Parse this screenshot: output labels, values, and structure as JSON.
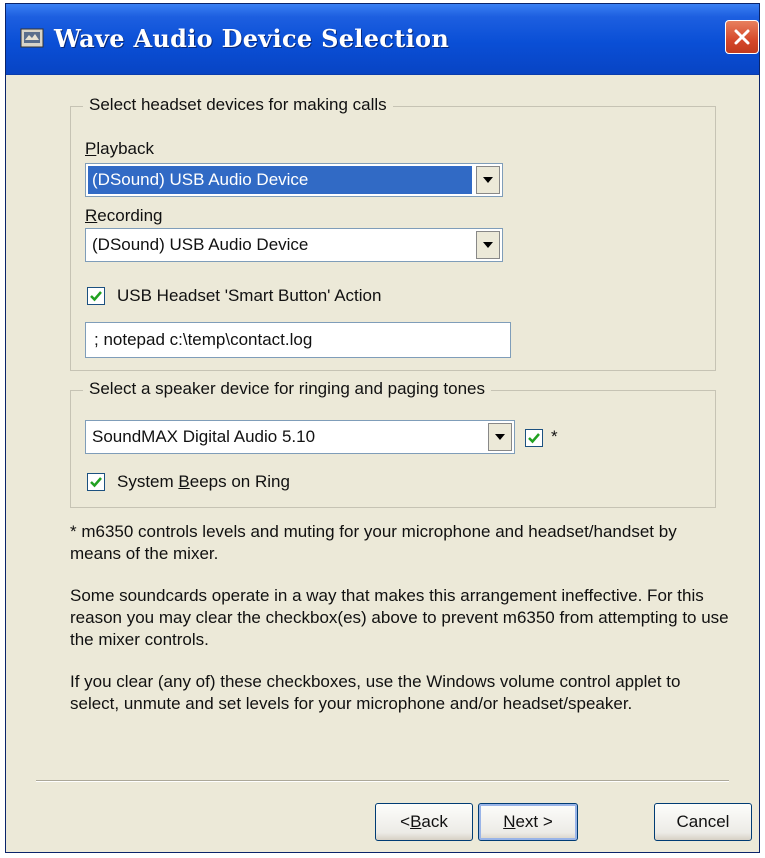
{
  "window": {
    "title": "Wave Audio Device Selection"
  },
  "headset_group": {
    "label": "Select headset devices for making calls",
    "playback": {
      "label_accel": "P",
      "label_rest": "layback",
      "value": "(DSound) USB Audio Device"
    },
    "recording": {
      "label_accel": "R",
      "label_rest": "ecording",
      "value": "(DSound) USB Audio Device"
    },
    "smart_button": {
      "checked": true,
      "label": "USB Headset 'Smart Button' Action"
    },
    "action_command": "; notepad c:\\temp\\contact.log"
  },
  "speaker_group": {
    "label": "Select a speaker device for ringing and paging tones",
    "device": {
      "value": "SoundMAX Digital Audio 5.10",
      "mixer_checked": true,
      "mixer_marker": "*"
    },
    "system_beeps": {
      "checked": true,
      "label_pre": "System ",
      "label_accel": "B",
      "label_rest": "eeps on Ring"
    }
  },
  "notes": {
    "p1": "* m6350 controls levels and muting for your microphone and headset/handset by means of the mixer.",
    "p2": "Some soundcards operate in a way that makes this arrangement ineffective. For this reason you may clear the checkbox(es) above to prevent m6350 from attempting to use the mixer controls.",
    "p3": "If you clear (any of) these checkboxes, use the Windows volume control applet to select, unmute and set levels for your microphone and/or headset/speaker."
  },
  "buttons": {
    "back": {
      "pre": "< ",
      "accel": "B",
      "rest": "ack"
    },
    "next": {
      "accel": "N",
      "rest": "ext >"
    },
    "cancel": "Cancel"
  },
  "colors": {
    "titlebar": "#0a4fd6",
    "selection": "#316ac5",
    "dialog_bg": "#ece9d8"
  }
}
